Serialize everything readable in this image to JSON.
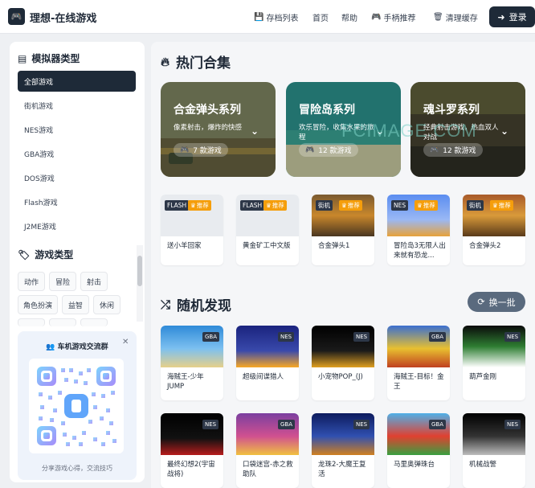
{
  "header": {
    "title": "理想-在线游戏",
    "nav": [
      {
        "label": "存档列表",
        "icon": "save-icon"
      },
      {
        "label": "首页",
        "icon": ""
      },
      {
        "label": "帮助",
        "icon": ""
      },
      {
        "label": "手柄推荐",
        "icon": "gamepad-icon"
      },
      {
        "label": "清理缓存",
        "icon": "trash-icon"
      }
    ],
    "login_label": "登录"
  },
  "sidebar": {
    "emulator_heading": "模拟器类型",
    "emulators": [
      "全部游戏",
      "街机游戏",
      "NES游戏",
      "GBA游戏",
      "DOS游戏",
      "Flash游戏",
      "J2ME游戏"
    ],
    "active_emulator": "全部游戏",
    "genre_heading": "游戏类型",
    "genres": [
      "动作",
      "冒险",
      "射击",
      "角色扮演",
      "益智",
      "休闲"
    ],
    "qr": {
      "title": "车机游戏交流群",
      "caption": "分享游戏心得，交流技巧"
    }
  },
  "hot": {
    "heading": "热门合集",
    "collections": [
      {
        "title": "合金弹头系列",
        "desc": "像素射击，爆炸的快感",
        "count": "7 款游戏",
        "color": "#6b7a58"
      },
      {
        "title": "冒险岛系列",
        "desc": "欢乐冒险，收集水果的旅程",
        "count": "12 款游戏",
        "color": "#2f7a74"
      },
      {
        "title": "魂斗罗系列",
        "desc": "经典射击游戏，热血双人对战",
        "count": "12 款游戏",
        "color": "#4a4a36"
      }
    ],
    "games": [
      {
        "name": "送小羊回家",
        "platform": "FLASH",
        "recommend": "推荐"
      },
      {
        "name": "黄金矿工中文版",
        "platform": "FLASH",
        "recommend": "推荐"
      },
      {
        "name": "合金弹头1",
        "platform": "街机",
        "recommend": "推荐"
      },
      {
        "name": "冒险岛3无限人出来就有恐龙...",
        "platform": "NES",
        "recommend": "推荐"
      },
      {
        "name": "合金弹头2",
        "platform": "街机",
        "recommend": "推荐"
      }
    ]
  },
  "random": {
    "heading": "随机发现",
    "refresh_label": "换一批",
    "games": [
      {
        "name": "海贼王-少年JUMP",
        "platform": "GBA"
      },
      {
        "name": "超级间谍猎人",
        "platform": "NES"
      },
      {
        "name": "小宠物POP_(J)",
        "platform": "NES"
      },
      {
        "name": "海贼王-目标！金王",
        "platform": "GBA"
      },
      {
        "name": "葫芦金刚",
        "platform": "NES"
      },
      {
        "name": "最终幻想2(宇宙战将)",
        "platform": "NES"
      },
      {
        "name": "口袋迷宫-赤之救助队",
        "platform": "GBA"
      },
      {
        "name": "龙珠2-大魔王复活",
        "platform": "NES"
      },
      {
        "name": "马里奥弹珠台",
        "platform": "GBA"
      },
      {
        "name": "机械战警",
        "platform": "NES"
      }
    ]
  },
  "watermark": "FCIMAGE.COM"
}
